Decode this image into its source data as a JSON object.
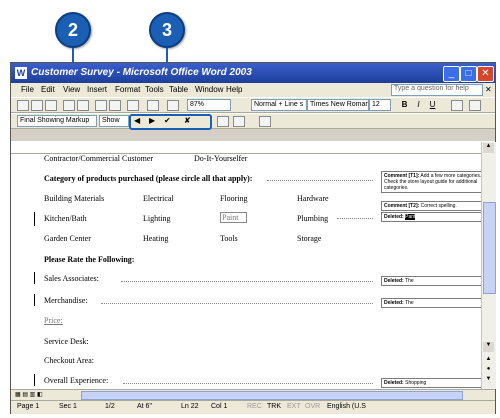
{
  "callouts": {
    "one": "2",
    "two": "3"
  },
  "window": {
    "title": "Customer Survey - Microsoft Office Word 2003",
    "controls": [
      "_",
      "□",
      "✕"
    ]
  },
  "menu": {
    "items": [
      "File",
      "Edit",
      "View",
      "Insert",
      "Format",
      "Tools",
      "Table",
      "Window",
      "Help"
    ],
    "ask_placeholder": "Type a question for help"
  },
  "standard_toolbar": {
    "zoom": "87%"
  },
  "formatting_toolbar": {
    "style": "Normal + Line s",
    "font": "Times New Roman",
    "size": "12",
    "bold": "B",
    "italic": "I",
    "underline": "U"
  },
  "reviewing_toolbar": {
    "display_for_review": "Final Showing Markup",
    "show": "Show"
  },
  "document": {
    "line1_left": "Contractor/Commercial Customer",
    "line1_right": "Do-It-Yourselfer",
    "category_heading": "Category of products purchased (please circle all that apply):",
    "row1": [
      "Building Materials",
      "Electrical",
      "Flooring",
      "Hardware"
    ],
    "row2": [
      "Kitchen/Bath",
      "Lighting",
      "Paint",
      "Plumbing"
    ],
    "row3": [
      "Garden Center",
      "Heating",
      "Tools",
      "Storage"
    ],
    "rate_heading": "Please Rate the Following:",
    "rate_items": [
      "Sales Associates:",
      "Merchandise:",
      "Price:",
      "Service Desk:",
      "Checkout Area:",
      "Overall Experience:"
    ]
  },
  "balloons": {
    "c1_label": "Comment [T1]:",
    "c1_text": "Add a few more categories. Check the store layout guide for additional categories.",
    "c2_label": "Comment [T2]:",
    "c2_text": "Correct spelling.",
    "d1_label": "Deleted:",
    "d1_text": "Pant",
    "d2_label": "Deleted:",
    "d2_text": "The",
    "d3_label": "Deleted:",
    "d3_text": "The",
    "d4_label": "Deleted:",
    "d4_text": "Shopping"
  },
  "status": {
    "page": "Page 1",
    "sec": "Sec 1",
    "of": "1/2",
    "at": "At 6\"",
    "ln": "Ln 22",
    "col": "Col 1",
    "rec": "REC",
    "trk": "TRK",
    "ext": "EXT",
    "ovr": "OVR",
    "lang": "English (U.S"
  }
}
